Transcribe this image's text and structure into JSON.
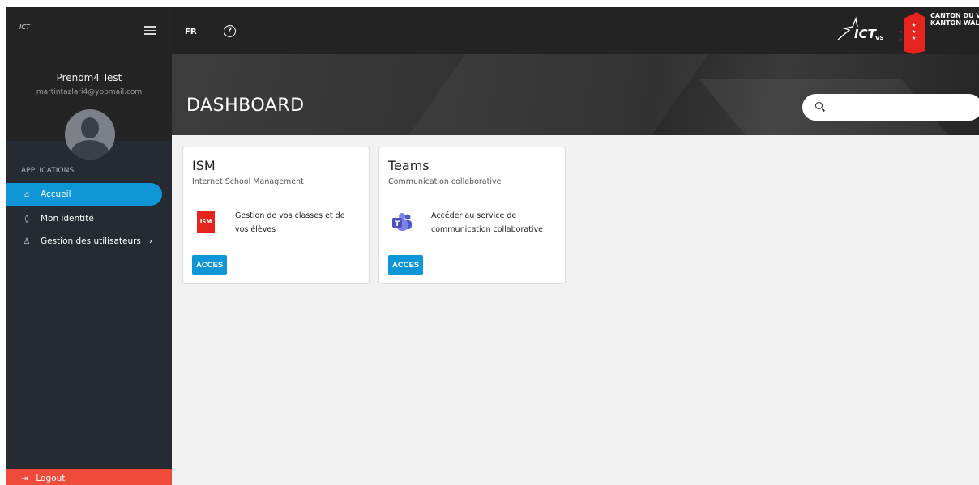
{
  "sidebar": {
    "logo_text": "ICT",
    "user_name": "Prenom4 Test",
    "user_email": "martintazlari4@yopmail.com",
    "section_label": "APPLICATIONS",
    "items": [
      {
        "label": "Accueil",
        "icon": "home-icon",
        "active": true
      },
      {
        "label": "Mon identité",
        "icon": "shield-icon",
        "active": false
      },
      {
        "label": "Gestion des utilisateurs",
        "icon": "users-icon",
        "active": false,
        "chevron": "›"
      }
    ],
    "logout_label": "Logout"
  },
  "topbar": {
    "language": "FR",
    "help_icon": "help-icon",
    "ict_logo_text": "ICT",
    "ict_logo_sub": "VS",
    "canton_line1": "CANTON DU VALA",
    "canton_line2": "KANTON WALLIS"
  },
  "hero": {
    "title": "DASHBOARD",
    "search_placeholder": ""
  },
  "cards": [
    {
      "title": "ISM",
      "subtitle": "Internet School Management",
      "description": "Gestion de vos classes et de vos élèves",
      "logo_text": "ISM",
      "button_label": "ACCES"
    },
    {
      "title": "Teams",
      "subtitle": "Communication collaborative",
      "description": "Accéder au service de communication collaborative",
      "logo_text": "T",
      "button_label": "ACCES"
    }
  ],
  "colors": {
    "accent": "#0f96d7",
    "logout": "#f04a3a",
    "sidebar": "#252a33",
    "topbar": "#232323",
    "ism_red": "#e4241d",
    "teams_purple": "#5059c9"
  }
}
